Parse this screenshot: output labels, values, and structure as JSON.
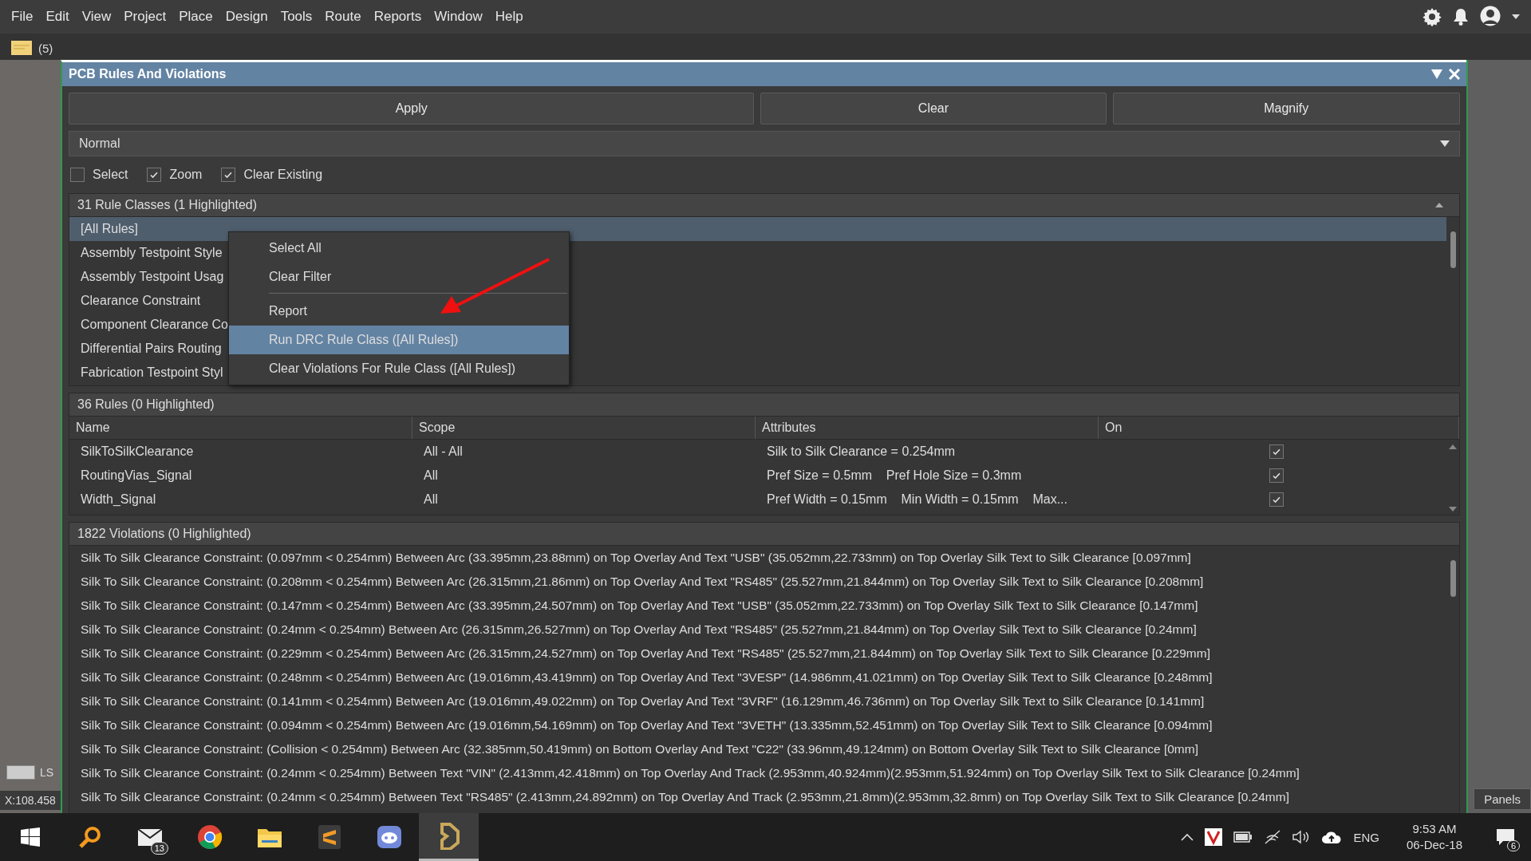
{
  "menu_bar": {
    "items": [
      "File",
      "Edit",
      "View",
      "Project",
      "Place",
      "Design",
      "Tools",
      "Route",
      "Reports",
      "Window",
      "Help"
    ]
  },
  "document_tabs": [
    {
      "label": "(5)",
      "selected": false
    }
  ],
  "panel": {
    "title": "PCB Rules And Violations",
    "buttons": [
      "Apply",
      "Clear",
      "Magnify"
    ],
    "mode_dropdown": {
      "value": "Normal"
    },
    "options": [
      {
        "label": "Select",
        "checked": false
      },
      {
        "label": "Zoom",
        "checked": true
      },
      {
        "label": "Clear Existing",
        "checked": true
      }
    ],
    "rule_classes": {
      "header": "31 Rule Classes (1 Highlighted)",
      "items": [
        {
          "label": "[All Rules]",
          "selected": true
        },
        {
          "label": "Assembly Testpoint Style",
          "selected": false
        },
        {
          "label": "Assembly Testpoint Usag",
          "selected": false
        },
        {
          "label": "Clearance Constraint",
          "selected": false
        },
        {
          "label": "Component Clearance Co",
          "selected": false
        },
        {
          "label": "Differential Pairs Routing",
          "selected": false
        },
        {
          "label": "Fabrication Testpoint Styl",
          "selected": false
        }
      ]
    },
    "context_menu": {
      "items": [
        {
          "label": "Select All",
          "selected": false
        },
        {
          "label": "Clear Filter",
          "selected": false
        },
        {
          "kind": "separator"
        },
        {
          "label": "Report",
          "selected": false
        },
        {
          "label": "Run DRC Rule Class ([All Rules])",
          "selected": true
        },
        {
          "label": "Clear Violations For Rule Class ([All Rules])",
          "selected": false
        }
      ]
    },
    "rules": {
      "header": "36 Rules (0 Highlighted)",
      "columns": [
        "Name",
        "Scope",
        "Attributes",
        "On"
      ],
      "rows": [
        {
          "name": "SilkToSilkClearance",
          "scope": "All - All",
          "attributes": "Silk to Silk Clearance = 0.254mm",
          "on": true
        },
        {
          "name": "RoutingVias_Signal",
          "scope": "All",
          "attributes": "Pref Size = 0.5mm    Pref Hole Size = 0.3mm",
          "on": true
        },
        {
          "name": "Width_Signal",
          "scope": "All",
          "attributes": "Pref Width = 0.15mm    Min Width = 0.15mm    Max...",
          "on": true
        }
      ]
    },
    "violations": {
      "header": "1822 Violations (0 Highlighted)",
      "items": [
        "Silk To Silk Clearance Constraint: (0.097mm < 0.254mm) Between Arc (33.395mm,23.88mm) on Top Overlay And Text \"USB\" (35.052mm,22.733mm) on Top Overlay Silk Text to Silk Clearance [0.097mm]",
        "Silk To Silk Clearance Constraint: (0.208mm < 0.254mm) Between Arc (26.315mm,21.86mm) on Top Overlay And Text \"RS485\" (25.527mm,21.844mm) on Top Overlay Silk Text to Silk Clearance [0.208mm]",
        "Silk To Silk Clearance Constraint: (0.147mm < 0.254mm) Between Arc (33.395mm,24.507mm) on Top Overlay And Text \"USB\" (35.052mm,22.733mm) on Top Overlay Silk Text to Silk Clearance [0.147mm]",
        "Silk To Silk Clearance Constraint: (0.24mm < 0.254mm) Between Arc (26.315mm,26.527mm) on Top Overlay And Text \"RS485\" (25.527mm,21.844mm) on Top Overlay Silk Text to Silk Clearance [0.24mm]",
        "Silk To Silk Clearance Constraint: (0.229mm < 0.254mm) Between Arc (26.315mm,24.527mm) on Top Overlay And Text \"RS485\" (25.527mm,21.844mm) on Top Overlay Silk Text to Silk Clearance [0.229mm]",
        "Silk To Silk Clearance Constraint: (0.248mm < 0.254mm) Between Arc (19.016mm,43.419mm) on Top Overlay And Text \"3VESP\" (14.986mm,41.021mm) on Top Overlay Silk Text to Silk Clearance [0.248mm]",
        "Silk To Silk Clearance Constraint: (0.141mm < 0.254mm) Between Arc (19.016mm,49.022mm) on Top Overlay And Text \"3VRF\" (16.129mm,46.736mm) on Top Overlay Silk Text to Silk Clearance [0.141mm]",
        "Silk To Silk Clearance Constraint: (0.094mm < 0.254mm) Between Arc (19.016mm,54.169mm) on Top Overlay And Text \"3VETH\" (13.335mm,52.451mm) on Top Overlay Silk Text to Silk Clearance [0.094mm]",
        "Silk To Silk Clearance Constraint: (Collision < 0.254mm) Between Arc (32.385mm,50.419mm) on Bottom Overlay And Text \"C22\" (33.96mm,49.124mm) on Bottom Overlay Silk Text to Silk Clearance [0mm]",
        "Silk To Silk Clearance Constraint: (0.24mm < 0.254mm) Between Text \"VIN\" (2.413mm,42.418mm) on Top Overlay And Track (2.953mm,40.924mm)(2.953mm,51.924mm) on Top Overlay Silk Text to Silk Clearance [0.24mm]",
        "Silk To Silk Clearance Constraint: (0.24mm < 0.254mm) Between Text \"RS485\" (2.413mm,24.892mm) on Top Overlay And Track (2.953mm,21.8mm)(2.953mm,32.8mm) on Top Overlay Silk Text to Silk Clearance [0.24mm]"
      ]
    }
  },
  "left_strip": {
    "layer_label": "LS",
    "coordinates": "X:108.458"
  },
  "panels_button": "Panels",
  "taskbar": {
    "mail_badge": "13",
    "apps": [
      {
        "kind": "mail",
        "active": false
      },
      {
        "kind": "browser",
        "active": false
      },
      {
        "kind": "folder",
        "active": false
      },
      {
        "kind": "editor",
        "active": false
      },
      {
        "kind": "chat",
        "active": false
      },
      {
        "kind": "pcb",
        "active": true
      }
    ],
    "language": "ENG",
    "time": "9:53 AM",
    "date": "06-Dec-18",
    "notification_count": "6"
  }
}
